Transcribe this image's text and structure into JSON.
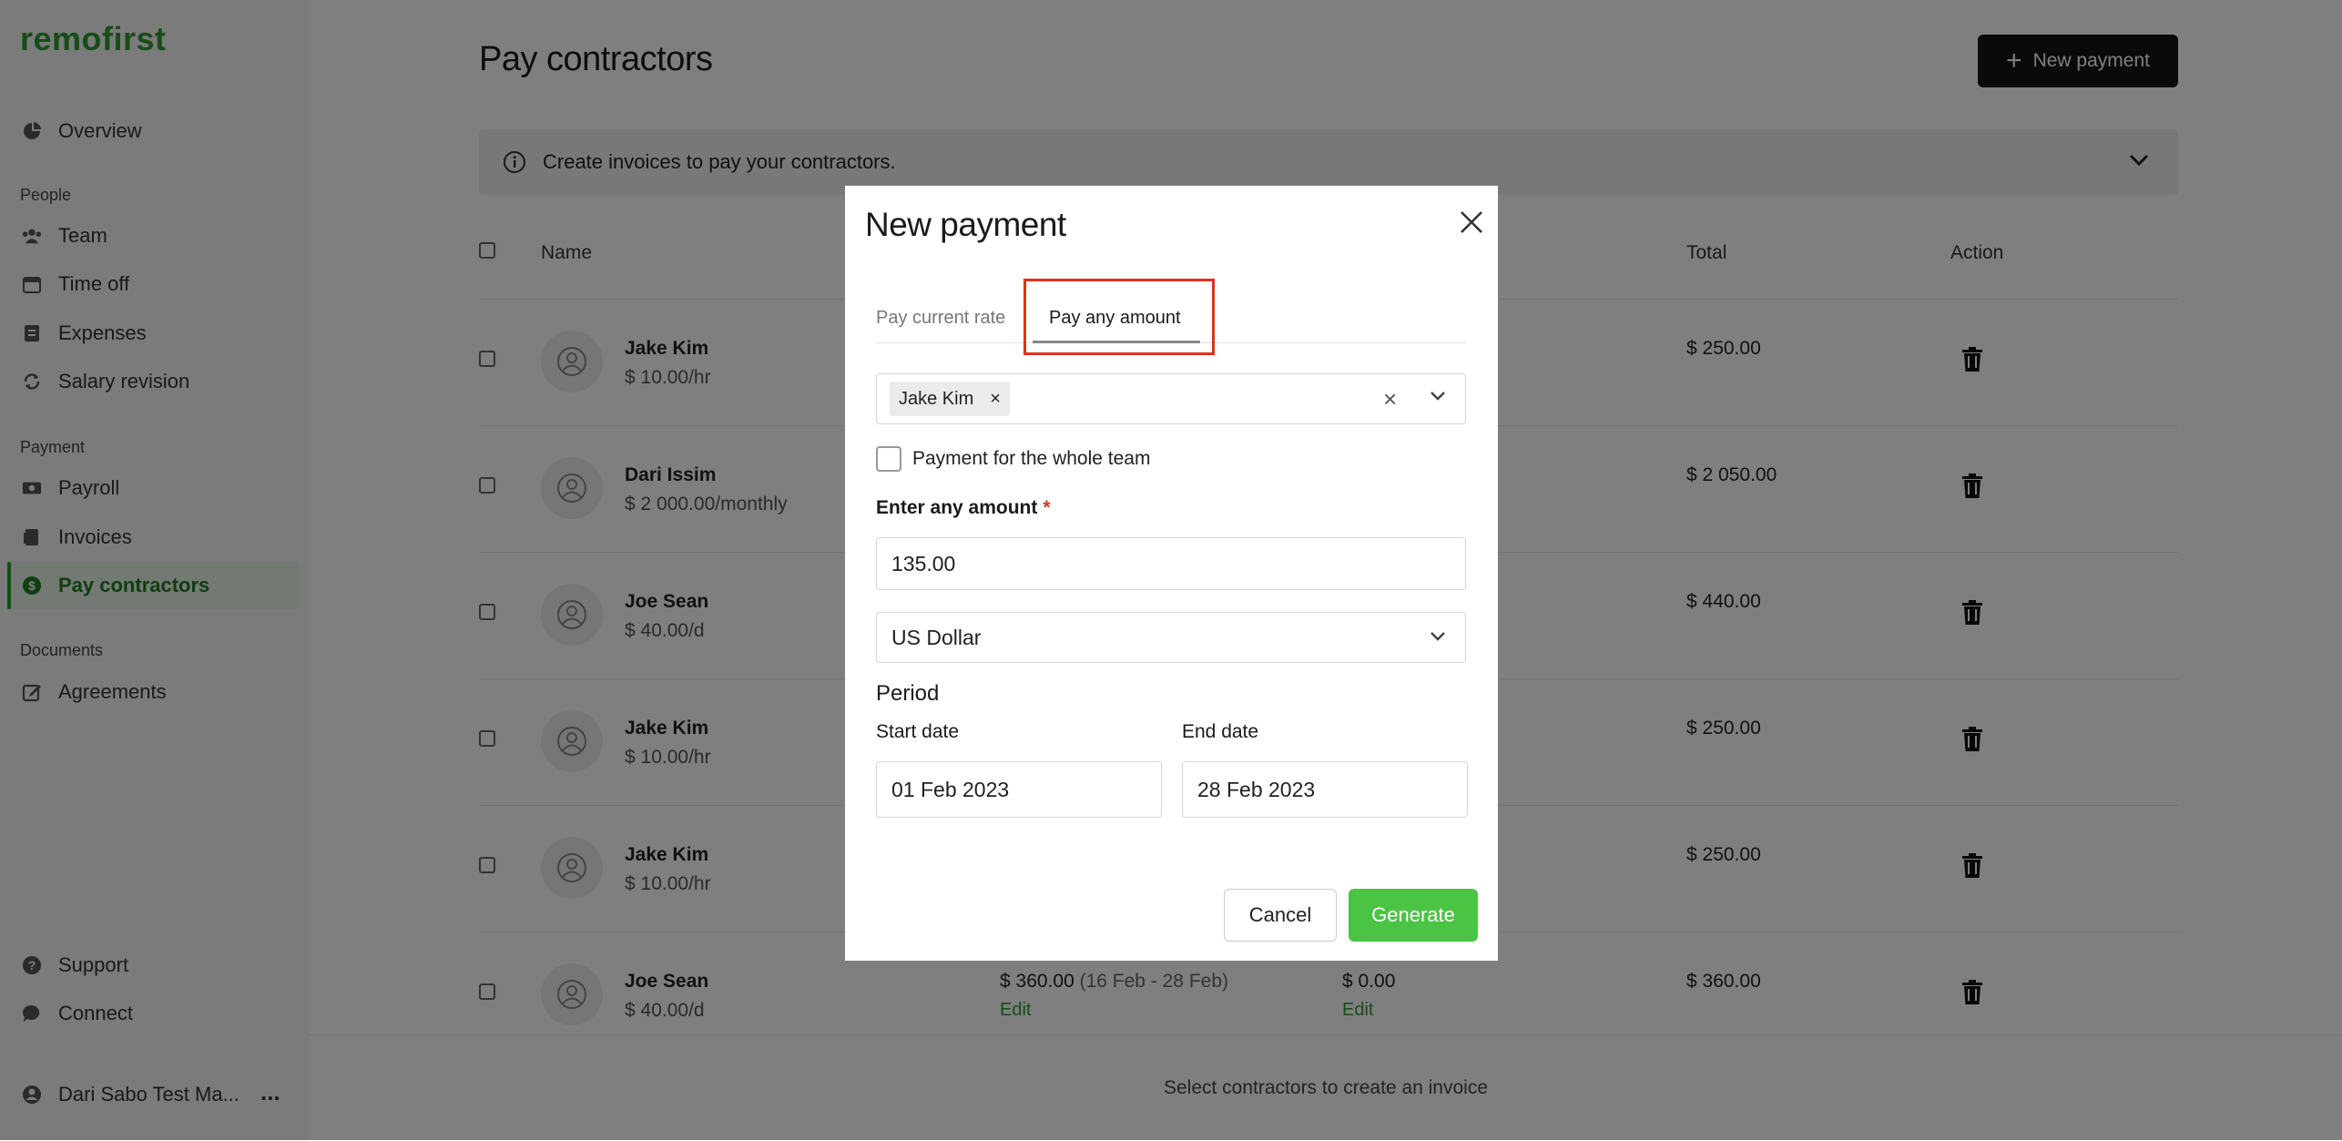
{
  "brand": {
    "name": "remofirst",
    "color": "#2e9b31"
  },
  "sidebar": {
    "items_top": [
      {
        "label": "Overview",
        "icon": "pie-chart-icon"
      }
    ],
    "people_label": "People",
    "people": [
      {
        "label": "Team",
        "icon": "users-icon"
      },
      {
        "label": "Time off",
        "icon": "calendar-icon"
      },
      {
        "label": "Expenses",
        "icon": "receipt-icon"
      },
      {
        "label": "Salary revision",
        "icon": "refresh-icon"
      }
    ],
    "payment_label": "Payment",
    "payment": [
      {
        "label": "Payroll",
        "icon": "money-icon"
      },
      {
        "label": "Invoices",
        "icon": "document-icon"
      },
      {
        "label": "Pay contractors",
        "icon": "dollar-icon",
        "active": true
      }
    ],
    "documents_label": "Documents",
    "documents": [
      {
        "label": "Agreements",
        "icon": "edit-icon"
      }
    ],
    "bottom": [
      {
        "label": "Support",
        "icon": "help-icon"
      },
      {
        "label": "Connect",
        "icon": "chat-icon"
      }
    ],
    "account": {
      "label": "Dari Sabo Test Ma...",
      "menu": "..."
    }
  },
  "page": {
    "title": "Pay contractors",
    "new_button": "New payment",
    "info_text": "Create invoices to pay your contractors.",
    "footer_text": "Select contractors to create an invoice"
  },
  "table": {
    "headers": {
      "name": "Name",
      "total": "Total",
      "action": "Action"
    },
    "rows": [
      {
        "name": "Jake Kim",
        "rate": "$ 10.00/hr",
        "total": "$ 250.00"
      },
      {
        "name": "Dari Issim",
        "rate": "$ 2 000.00/monthly",
        "total": "$ 2 050.00"
      },
      {
        "name": "Joe Sean",
        "rate": "$ 40.00/d",
        "total": "$ 440.00"
      },
      {
        "name": "Jake Kim",
        "rate": "$ 10.00/hr",
        "total": "$ 250.00"
      },
      {
        "name": "Jake Kim",
        "rate": "$ 10.00/hr",
        "total": "$ 250.00"
      },
      {
        "name": "Joe Sean",
        "rate": "$ 40.00/d",
        "total": "$ 360.00",
        "amount": "$ 360.00",
        "period": "(16 Feb - 28 Feb)",
        "edit1": "Edit",
        "extra": "$ 0.00",
        "edit2": "Edit"
      }
    ]
  },
  "modal": {
    "title": "New payment",
    "tabs": [
      "Pay current rate",
      "Pay any amount"
    ],
    "active_tab": "Pay any amount",
    "selected_contractor": "Jake Kim",
    "chip_remove": "×",
    "clear": "×",
    "whole_team_label": "Payment for the whole team",
    "amount_label": "Enter any amount",
    "required_mark": "*",
    "amount_value": "135.00",
    "currency": "US Dollar",
    "period_label": "Period",
    "start_label": "Start date",
    "start_value": "01 Feb 2023",
    "end_label": "End date",
    "end_value": "28 Feb 2023",
    "cancel": "Cancel",
    "generate": "Generate",
    "generate_color": "#4cc443",
    "highlight_color": "#e0321d"
  }
}
